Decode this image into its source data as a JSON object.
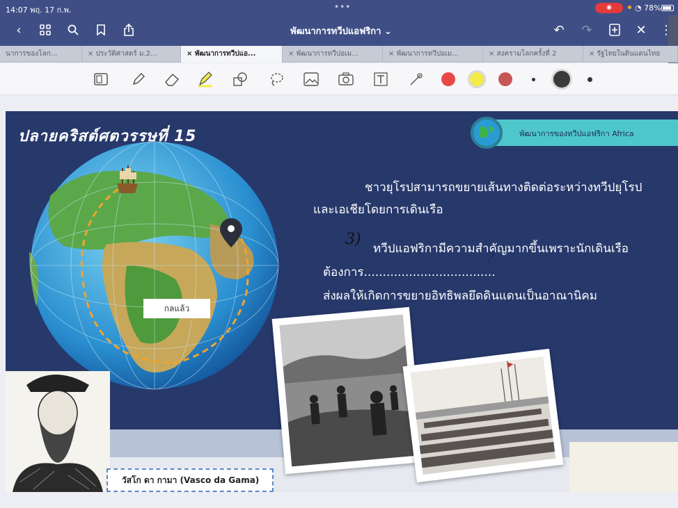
{
  "status": {
    "time": "14:07",
    "date": "พฤ. 17 ก.พ.",
    "battery": "78%"
  },
  "nav": {
    "title": "พัฒนาการทวีปแอฟริกา ⌄"
  },
  "tabs": [
    {
      "label": "นาการของโลก..."
    },
    {
      "label": "× ประวัติศาสตร์ ม.2..."
    },
    {
      "label": "× พัฒนาการทวีปแอ..."
    },
    {
      "label": "× พัฒนาการทวีปอเม..."
    },
    {
      "label": "× พัฒนาการทวีปอเม..."
    },
    {
      "label": "× สงครามโลกครั้งที่ 2"
    },
    {
      "label": "× รัฐไทยในดินแดนไทย"
    }
  ],
  "colors": {
    "red": "#e84848",
    "yellow": "#f2ec4a",
    "darkred": "#c85656",
    "black": "#3a3a3a",
    "slide_bg": "#27386b",
    "accent": "#4ec7cc"
  },
  "slide": {
    "title": "ปลายคริสต์ศตวรรษที่ 15",
    "topic": "พัฒนาการของทวีปแอฟริกา Africa",
    "line1": "ชาวยุโรปสามารถขยายเส้นทางติดต่อระหว่างทวีปยุโรป",
    "line2": "และเอเชียโดยการเดินเรือ",
    "line3": "ทวีปแอฟริกามีความสำคัญมากขึ้นเพราะนักเดินเรือ",
    "line4": "ต้องการ...................................",
    "line5": "ส่งผลให้เกิดการขยายอิทธิพลยึดดินแดนเป็นอาณานิคม",
    "hand_number": "3)",
    "hand_mark": "?",
    "globe_label": "กลแล้ว",
    "caption": "วัสโก ดา กามา (Vasco da Gama)"
  }
}
